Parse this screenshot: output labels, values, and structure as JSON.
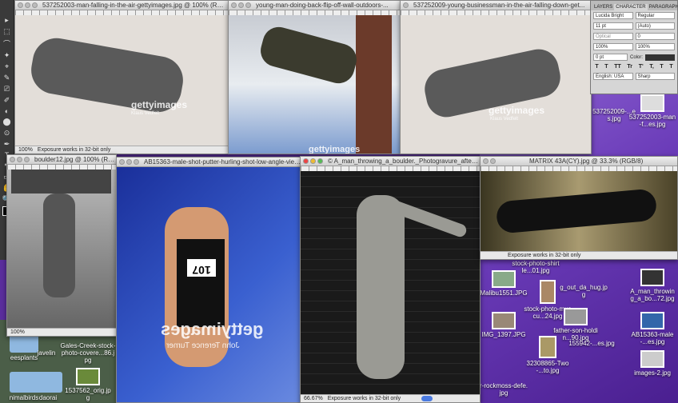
{
  "windows": {
    "w1": {
      "title": "537252003-man-falling-in-the-air-gettyimages.jpg @ 100% (RGB/8)",
      "zoom": "100%",
      "status": "Exposure works in 32-bit only",
      "watermark": "gettyimages",
      "credit": "Klaus Vedfelt"
    },
    "w2": {
      "title": "young-man-doing-back-flip-off-wall-outdoors-...",
      "watermark": "gettyimages"
    },
    "w3": {
      "title": "537252009-young-businessman-in-the-air-falling-down-get...",
      "watermark": "gettyimages",
      "credit": "Klaus Vedfelt"
    },
    "w4": {
      "title": "boulder12.jpg @ 100% (RGB/8)",
      "zoom": "100%"
    },
    "w5": {
      "title": "AB15363-male-shot-putter-hurling-shot-low-angle-view...",
      "watermark": "gettyimages",
      "credit": "John Terence Turner",
      "bib": "107"
    },
    "w6": {
      "title": "© A_man_throwing_a_boulder._Photogravure_after_E...",
      "zoom": "66.67%",
      "status": "Exposure works in 32-bit only"
    },
    "w7": {
      "title": "MATRIX 43A(CY).jpg @ 33.3% (RGB/8)",
      "status": "Exposure works in 32-bit only"
    }
  },
  "character_panel": {
    "tabs": [
      "LAYERS",
      "CHARACTER",
      "PARAGRAPH"
    ],
    "font": "Lucida Bright",
    "style": "Regular",
    "size": "11 pt",
    "leading": "(Auto)",
    "kerning": "Optical",
    "tracking": "0",
    "vscale": "100%",
    "hscale": "100%",
    "baseline": "0 pt",
    "color_label": "Color:",
    "language": "English: USA",
    "antialias": "Sharp",
    "styles": [
      "T",
      "T",
      "TT",
      "Tr",
      "T'",
      "T,",
      "T",
      "T"
    ]
  },
  "tools": [
    "▸",
    "⬚",
    "⌒",
    "✦",
    "⌖",
    "✎",
    "⎚",
    "✐",
    "◐",
    "⬤",
    "⊙",
    "✒",
    "T",
    "↖",
    "▭",
    "✋",
    "🔍"
  ],
  "desktop_left": [
    {
      "label": "javelin",
      "kind": "folder"
    },
    {
      "label": "eesplants",
      "kind": "folder"
    },
    {
      "label": "Gales-Creek-stock-photo-covere...86.jpg",
      "kind": "image"
    },
    {
      "label": "nimalbirds",
      "kind": "folder"
    },
    {
      "label": "daorai",
      "kind": "folder"
    },
    {
      "label": "1537562_orig.jpg",
      "kind": "image"
    }
  ],
  "desktop_right": [
    {
      "label": "537252009-...es.jpg"
    },
    {
      "label": "537252003-man-f...es.jpg"
    },
    {
      "label": "stock-photo-shirtle...01.jpg"
    },
    {
      "label": "Malibu1551.JPG"
    },
    {
      "label": "stock-photo-muscu...24.jpg"
    },
    {
      "label": "g_out_da_hug.jpg"
    },
    {
      "label": "father-son-holdin...90.jpg"
    },
    {
      "label": "IMG_1397.JPG"
    },
    {
      "label": "32308865-Two-...to.jpg"
    },
    {
      "label": "155942-...es.jpg"
    },
    {
      "label": "r-rockmoss-defe.jpg"
    },
    {
      "label": "A_man_throwing_a_bo...72.jpg"
    },
    {
      "label": "AB15363-male-...es.jpg"
    },
    {
      "label": "images-2.jpg"
    }
  ]
}
